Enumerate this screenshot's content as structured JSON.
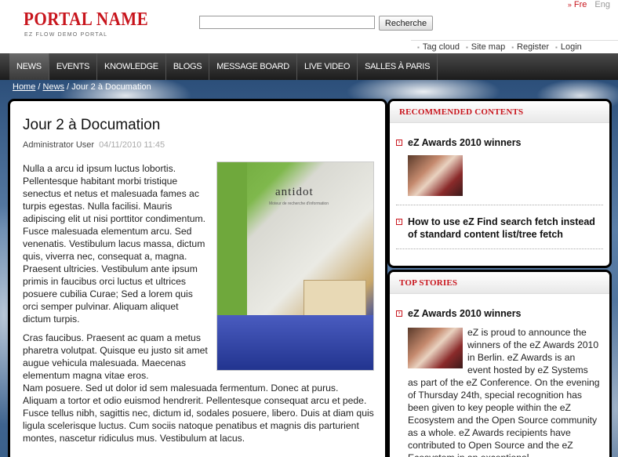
{
  "header": {
    "logo_name": "PORTAL NAME",
    "logo_tagline": "EZ FLOW DEMO PORTAL",
    "search_placeholder": "",
    "search_button": "Recherche",
    "lang_fre": "Fre",
    "lang_eng": "Eng",
    "utility": [
      "Tag cloud",
      "Site map",
      "Register",
      "Login"
    ]
  },
  "nav": {
    "items": [
      "NEWS",
      "EVENTS",
      "KNOWLEDGE",
      "BLOGS",
      "MESSAGE BOARD",
      "LIVE VIDEO",
      "SALLES À PARIS"
    ],
    "active": "NEWS"
  },
  "breadcrumb": {
    "home": "Home",
    "news": "News",
    "current": "Jour 2 à Documation",
    "sep": " / "
  },
  "article": {
    "title": "Jour 2 à Documation",
    "author": "Administrator User",
    "date": "04/11/2010 11:45",
    "image_text": "antidot",
    "image_subtext": "Moteur de recherche d'information",
    "para1": "Nulla a arcu id ipsum luctus lobortis. Pellentesque habitant morbi tristique senectus et netus et malesuada fames ac turpis egestas. Nulla facilisi. Mauris adipiscing elit ut nisi porttitor condimentum. Fusce malesuada elementum arcu. Sed venenatis. Vestibulum lacus massa, dictum quis, viverra nec, consequat a, magna. Praesent ultricies. Vestibulum ante ipsum primis in faucibus orci luctus et ultrices posuere cubilia Curae; Sed a lorem quis orci semper pulvinar. Aliquam aliquet dictum turpis.",
    "para2_narrow": "Cras faucibus. Praesent ac quam a metus pharetra volutpat. Quisque eu justo sit amet augue vehicula malesuada. Maecenas elementum magna vitae eros.",
    "para2_wide": "Nam posuere. Sed ut dolor id sem malesuada fermentum. Donec at purus. Aliquam a tortor et odio euismod hendrerit. Pellentesque consequat arcu et pede. Fusce tellus nibh, sagittis nec, dictum id, sodales posuere, libero. Duis at diam quis ligula scelerisque luctus. Cum sociis natoque penatibus et magnis dis parturient montes, nascetur ridiculus mus. Vestibulum at lacus."
  },
  "recommended": {
    "heading": "RECOMMENDED CONTENTS",
    "items": [
      {
        "title": "eZ Awards 2010 winners"
      },
      {
        "title": "How to use eZ Find search fetch instead of standard content list/tree fetch"
      }
    ]
  },
  "top_stories": {
    "heading": "TOP STORIES",
    "title": "eZ Awards 2010 winners",
    "text": "eZ is proud to announce the winners of the eZ Awards 2010 in Berlin. eZ Awards is an event hosted by eZ Systems as part of the eZ Conference. On the evening of Thursday 24th, special recognition has been given to key people within the eZ Ecosystem and the Open Source community as a whole. eZ Awards recipients have contributed to Open Source and the eZ Ecosystem in an exceptional"
  },
  "colors": {
    "brand_red": "#c8151d",
    "nav_dark": "#1c1c1c"
  }
}
